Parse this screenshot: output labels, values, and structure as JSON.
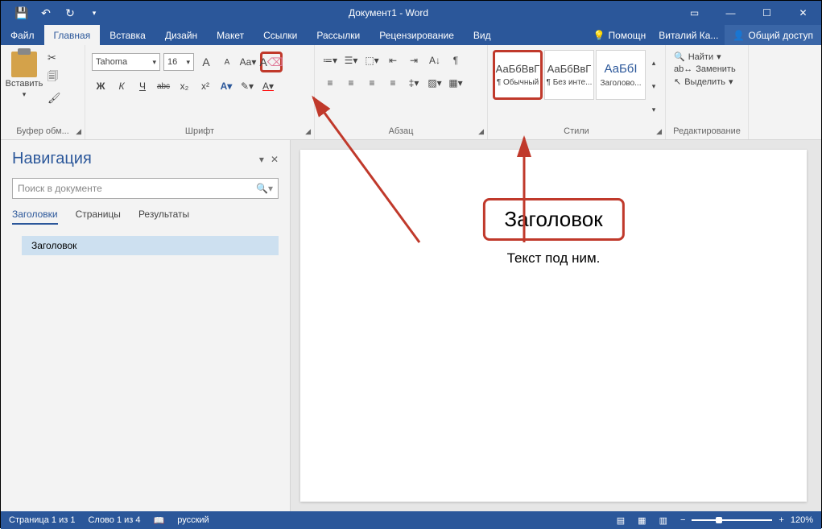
{
  "titlebar": {
    "document_title": "Документ1 - Word"
  },
  "menubar": {
    "tabs": [
      "Файл",
      "Главная",
      "Вставка",
      "Дизайн",
      "Макет",
      "Ссылки",
      "Рассылки",
      "Рецензирование",
      "Вид"
    ],
    "help": "Помощн",
    "user": "Виталий Ка...",
    "share": "Общий доступ"
  },
  "ribbon": {
    "clipboard": {
      "paste": "Вставить",
      "label": "Буфер обм..."
    },
    "font": {
      "name": "Tahoma",
      "size": "16",
      "grow": "A",
      "shrink": "A",
      "case": "Aa",
      "bold": "Ж",
      "italic": "К",
      "underline": "Ч",
      "strike": "abc",
      "sub": "x₂",
      "sup": "x²",
      "label": "Шрифт"
    },
    "paragraph": {
      "label": "Абзац"
    },
    "styles": {
      "items": [
        {
          "preview": "АаБбВвГ",
          "name": "¶ Обычный"
        },
        {
          "preview": "АаБбВвГ",
          "name": "¶ Без инте..."
        },
        {
          "preview": "АаБбІ",
          "name": "Заголово..."
        }
      ],
      "label": "Стили"
    },
    "editing": {
      "find": "Найти",
      "replace": "Заменить",
      "select": "Выделить",
      "label": "Редактирование"
    }
  },
  "nav": {
    "title": "Навигация",
    "search_placeholder": "Поиск в документе",
    "tabs": [
      "Заголовки",
      "Страницы",
      "Результаты"
    ],
    "heading": "Заголовок"
  },
  "document": {
    "heading": "Заголовок",
    "body": "Текст под ним."
  },
  "status": {
    "page": "Страница 1 из 1",
    "words": "Слово 1 из 4",
    "lang": "русский",
    "zoom": "120%"
  }
}
